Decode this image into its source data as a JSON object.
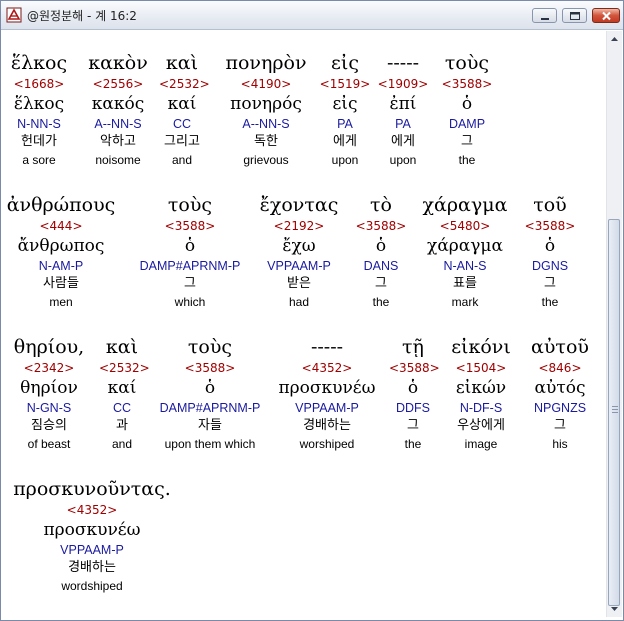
{
  "window": {
    "title": "@원정분해 - 계 16:2"
  },
  "rows": [
    {
      "words": [
        {
          "greek": "ἕλκος",
          "strong": "<1668>",
          "lemma": "ἕλκος",
          "parse": "N-NN-S",
          "korean": "헌데가",
          "english": "a sore"
        },
        {
          "greek": "κακὸν",
          "strong": "<2556>",
          "lemma": "κακός",
          "parse": "A--NN-S",
          "korean": "악하고",
          "english": "noisome"
        },
        {
          "greek": "καὶ",
          "strong": "<2532>",
          "lemma": "καί",
          "parse": "CC",
          "korean": "그리고",
          "english": "and"
        },
        {
          "greek": "πονηρὸν",
          "strong": "<4190>",
          "lemma": "πονηρός",
          "parse": "A--NN-S",
          "korean": "독한",
          "english": "grievous"
        },
        {
          "greek": "εἰς",
          "strong": "<1519>",
          "lemma": "εἰς",
          "parse": "PA",
          "korean": "에게",
          "english": "upon"
        },
        {
          "greek": "-----",
          "strong": "<1909>",
          "lemma": "ἐπί",
          "parse": "PA",
          "korean": "에게",
          "english": "upon"
        },
        {
          "greek": "τοὺς",
          "strong": "<3588>",
          "lemma": "ὁ",
          "parse": "DAMP",
          "korean": "그",
          "english": "the"
        }
      ]
    },
    {
      "words": [
        {
          "greek": "ἀνθρώπους",
          "strong": "<444>",
          "lemma": "ἄνθρωπος",
          "parse": "N-AM-P",
          "korean": "사람들",
          "english": "men"
        },
        {
          "greek": "τοὺς",
          "strong": "<3588>",
          "lemma": "ὁ",
          "parse": "DAMP#APRNM-P",
          "korean": "그",
          "english": "which"
        },
        {
          "greek": "ἔχοντας",
          "strong": "<2192>",
          "lemma": "ἔχω",
          "parse": "VPPAAM-P",
          "korean": "받은",
          "english": "had"
        },
        {
          "greek": "τὸ",
          "strong": "<3588>",
          "lemma": "ὁ",
          "parse": "DANS",
          "korean": "그",
          "english": "the"
        },
        {
          "greek": "χάραγμα",
          "strong": "<5480>",
          "lemma": "χάραγμα",
          "parse": "N-AN-S",
          "korean": "표를",
          "english": "mark"
        },
        {
          "greek": "τοῦ",
          "strong": "<3588>",
          "lemma": "ὁ",
          "parse": "DGNS",
          "korean": "그",
          "english": "the"
        }
      ]
    },
    {
      "words": [
        {
          "greek": "θηρίου,",
          "strong": "<2342>",
          "lemma": "θηρίον",
          "parse": "N-GN-S",
          "korean": "짐승의",
          "english": "of beast"
        },
        {
          "greek": "καὶ",
          "strong": "<2532>",
          "lemma": "καί",
          "parse": "CC",
          "korean": "과",
          "english": "and"
        },
        {
          "greek": "τοὺς",
          "strong": "<3588>",
          "lemma": "ὁ",
          "parse": "DAMP#APRNM-P",
          "korean": "자들",
          "english": "upon them which"
        },
        {
          "greek": "-----",
          "strong": "<4352>",
          "lemma": "προσκυνέω",
          "parse": "VPPAAM-P",
          "korean": "경배하는",
          "english": "worshiped"
        },
        {
          "greek": "τῇ",
          "strong": "<3588>",
          "lemma": "ὁ",
          "parse": "DDFS",
          "korean": "그",
          "english": "the"
        },
        {
          "greek": "εἰκόνι",
          "strong": "<1504>",
          "lemma": "εἰκών",
          "parse": "N-DF-S",
          "korean": "우상에게",
          "english": "image"
        },
        {
          "greek": "αὐτοῦ",
          "strong": "<846>",
          "lemma": "αὐτός",
          "parse": "NPGNZS",
          "korean": "그",
          "english": "his"
        }
      ]
    },
    {
      "words": [
        {
          "greek": "προσκυνοῦντας.",
          "strong": "<4352>",
          "lemma": "προσκυνέω",
          "parse": "VPPAAM-P",
          "korean": "경배하는",
          "english": "wordshiped"
        }
      ]
    }
  ]
}
